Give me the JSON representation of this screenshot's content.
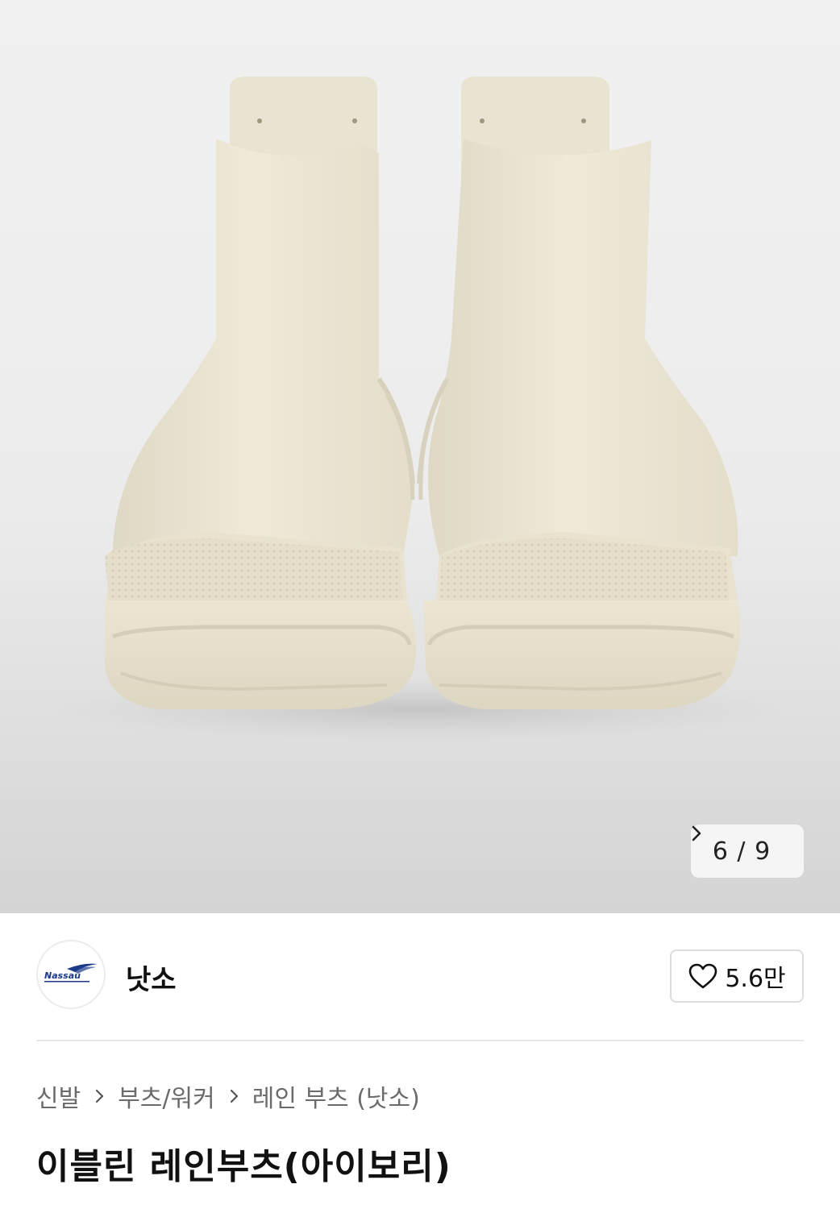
{
  "gallery": {
    "image_label": "rain boots product photo",
    "counter": "6 / 9"
  },
  "brand": {
    "logo_text": "Nassau",
    "name": "낫소",
    "likes": "5.6만"
  },
  "breadcrumb": {
    "items": [
      "신발",
      "부츠/워커",
      "레인 부츠 (낫소)"
    ]
  },
  "product": {
    "title": "이블린 레인부츠(아이보리)"
  },
  "colors": {
    "boot": "#ece6d4",
    "background": "#ececec",
    "text_primary": "#111111",
    "text_secondary": "#6b6b6b"
  }
}
